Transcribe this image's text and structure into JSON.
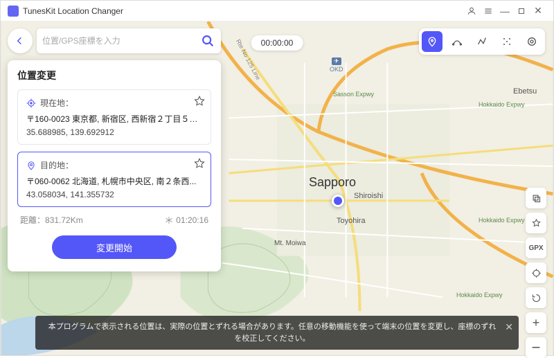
{
  "titlebar": {
    "title": "TunesKit Location Changer"
  },
  "search": {
    "placeholder": "位置/GPS座標を入力"
  },
  "panel": {
    "title": "位置変更",
    "current": {
      "label": "現在地：",
      "address": "〒160-0023 東京都, 新宿区, 西新宿２丁目５番, Ja...",
      "coords": "35.688985, 139.692912"
    },
    "destination": {
      "label": "目的地：",
      "address": "〒060-0062 北海道, 札幌市中央区, 南２条西...",
      "coords": "43.058034, 141.355732"
    },
    "distance_label": "距離：",
    "distance_value": "831.72Km",
    "eta": "01:20:16",
    "start_label": "変更開始"
  },
  "timer": "00:00:00",
  "tools": {
    "gpx": "GPX"
  },
  "notice": {
    "text": "本プログラムで表示される位置は、実際の位置とずれる場合があります。任意の移動機能を使って端末の位置を変更し、座標のずれを校正してください。"
  },
  "map_labels": {
    "sapporo": "Sapporo",
    "shiroishi": "Shiroishi",
    "toyohira": "Toyohira",
    "ebetsu": "Ebetsu",
    "moiwa": "Mt. Moiwa",
    "okd": "OKD",
    "sasson": "Sasson Expwy",
    "hokkaido": "Hokkaido Expwy",
    "route": "Rte No 125 Line"
  }
}
